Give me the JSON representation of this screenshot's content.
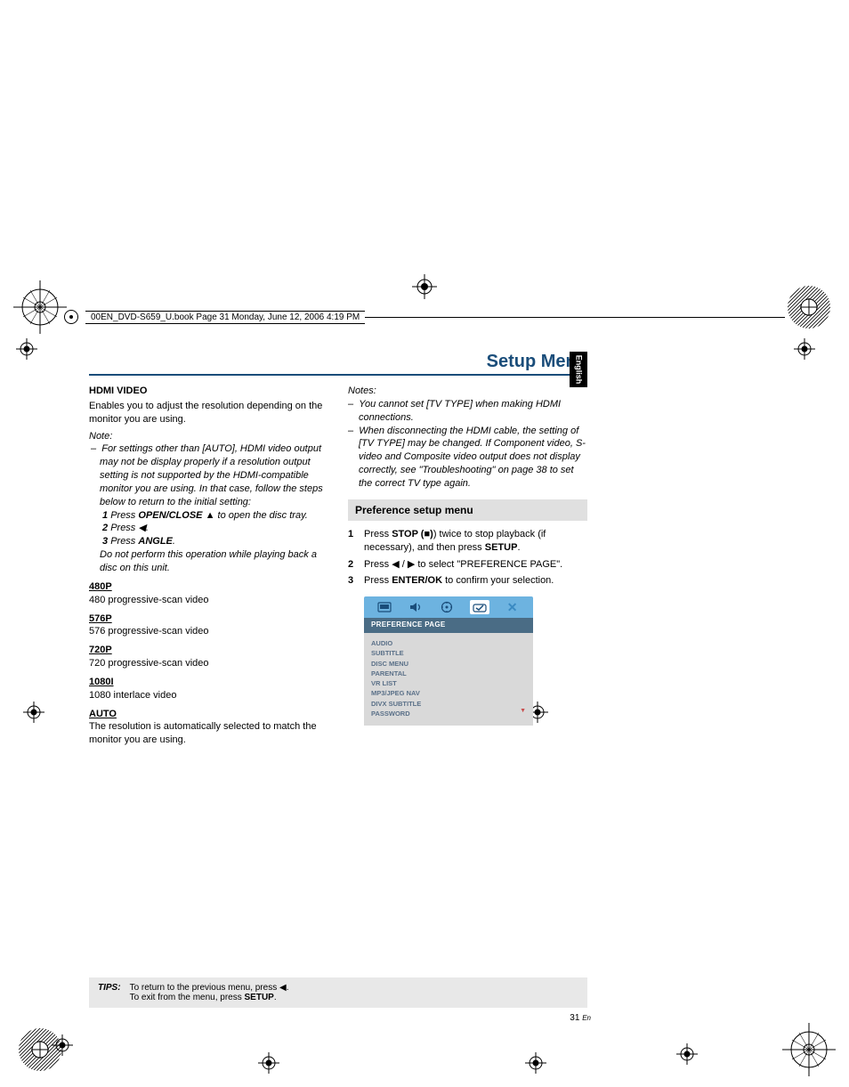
{
  "bookline": "00EN_DVD-S659_U.book  Page 31  Monday, June 12, 2006  4:19 PM",
  "page_title": "Setup Menu",
  "lang_tab": "English",
  "left": {
    "h_video": "HDMI VIDEO",
    "video_desc": "Enables you to adjust the resolution depending on the monitor you are using.",
    "note_label": "Note:",
    "note_item": "For settings other than [AUTO], HDMI video output may not be display properly if a resolution output setting is not supported by the HDMI-compatible monitor you are using. In that case, follow the steps below to return to the initial setting:",
    "step1_a": "Press ",
    "step1_b": "OPEN/CLOSE",
    "step1_c": " to open the disc tray.",
    "step2_a": "Press ",
    "step3_a": "Press ",
    "step3_b": "ANGLE",
    "do_not": "Do not perform this operation while playing back a disc on this unit.",
    "r480_h": "480P",
    "r480_t": "480 progressive-scan video",
    "r576_h": "576P",
    "r576_t": "576 progressive-scan video",
    "r720_h": "720P",
    "r720_t": "720 progressive-scan video",
    "r1080_h": "1080I",
    "r1080_t": "1080 interlace video",
    "auto_h": "AUTO",
    "auto_t": "The resolution is automatically selected to match the monitor you are using."
  },
  "right": {
    "notes_label": "Notes:",
    "note1": "You cannot set [TV TYPE] when making HDMI connections.",
    "note2": "When disconnecting the HDMI cable, the setting of [TV TYPE] may be changed. If Component video, S-video and Composite video output does not display correctly, see \"Troubleshooting\" on page 38 to set the correct TV type again.",
    "section": "Preference setup menu",
    "s1_a": "Press ",
    "s1_b": "STOP",
    "s1_c": " (",
    "s1_d": ") twice to stop playback (if necessary), and then press ",
    "s1_e": "SETUP",
    "s1_f": ".",
    "s2_a": "Press ",
    "s2_b": " to select \"PREFERENCE PAGE\".",
    "s3_a": "Press ",
    "s3_b": "ENTER/OK",
    "s3_c": " to confirm your selection.",
    "osd_sub": "PREFERENCE PAGE",
    "osd_items": [
      "AUDIO",
      "SUBTITLE",
      "DISC MENU",
      "PARENTAL",
      "VR LIST",
      "MP3/JPEG NAV",
      "DIVX SUBTITLE",
      "PASSWORD"
    ]
  },
  "tips": {
    "label": "TIPS:",
    "line1_a": "To return to the previous menu, press ",
    "line1_b": ".",
    "line2_a": "To exit from the menu, press ",
    "line2_b": "SETUP",
    "line2_c": "."
  },
  "page_number": "31",
  "page_suffix": "En"
}
